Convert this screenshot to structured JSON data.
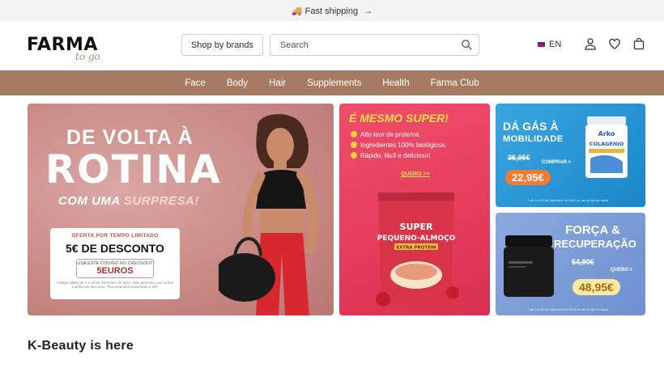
{
  "announcement": {
    "icon": "truck-icon",
    "text": "🚚 Fast shipping",
    "arrow": "→"
  },
  "header": {
    "logo_main": "FARMA",
    "logo_sub": "to go",
    "brands_button": "Shop by brands",
    "search_placeholder": "Search",
    "language": "EN"
  },
  "nav": {
    "items": [
      "Face",
      "Body",
      "Hair",
      "Supplements",
      "Health",
      "Farma Club"
    ]
  },
  "banners": {
    "main": {
      "line1": "DE VOLTA À",
      "line2": "ROTINA",
      "line3a": "COM UMA ",
      "line3b": "SURPRESA!",
      "promo_label": "OFERTA POR TEMPO LIMITADO",
      "discount": "5€ DE DESCONTO",
      "code_label": "USA ESTE CÓDIGO NO CHECKOUT",
      "code": "5EUROS",
      "fine": "Código válido de 2 a 15 de Setembro de 2024. Não acumula com outros cupões de desconto. *Encomendas superiores a 40€"
    },
    "super": {
      "heading": "É MESMO SUPER!",
      "bullets": [
        "Alto teor de proteína.",
        "Ingredientes 100% biológicos.",
        "Rápido, fácil e delicioso!"
      ],
      "cta": "QUERO >>",
      "pack_line1": "SUPER",
      "pack_line2": "PEQUENO-ALMOÇO",
      "pack_line3": "EXTRA PROTEIN"
    },
    "gas": {
      "line1": "DÁ GÁS À",
      "line2": "MOBILIDADE",
      "old_price": "35,95€",
      "cta": "COMPRAR >",
      "price": "22,95€",
      "brand": "Arko",
      "product": "COLAGÉNIO",
      "fine": "* de 2 a 15 de Setembro de 2024 ou até ao fim do stock"
    },
    "forca": {
      "line1": "FORÇA &",
      "line2": "RECUPERAÇÃO",
      "old_price": "54,90€",
      "cta": "QUERO >",
      "price": "48,95€",
      "fine": "* de 2 a 15 de Setembro de 2024 ou até ao fim do stock"
    }
  },
  "section": {
    "title": "K-Beauty is here"
  },
  "colors": {
    "nav_bg": "#a77b61",
    "accent": "#b88c6a"
  }
}
